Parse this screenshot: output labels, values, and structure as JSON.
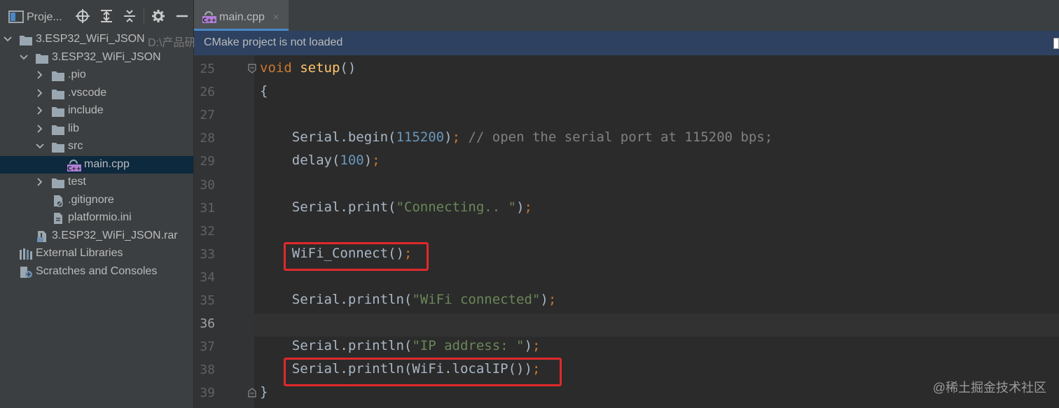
{
  "project_panel": {
    "title": "Proje...",
    "header_icons": [
      "locate-icon",
      "expand-all-icon",
      "collapse-all-icon",
      "gear-icon",
      "minimize-icon"
    ],
    "tree": [
      {
        "label": "3.ESP32_WiFi_JSON",
        "hint": "D:\\产品研发",
        "indent": 0,
        "arrow": "down",
        "icon": "folder"
      },
      {
        "label": "3.ESP32_WiFi_JSON",
        "hint": "",
        "indent": 1,
        "arrow": "down",
        "icon": "folder"
      },
      {
        "label": ".pio",
        "hint": "",
        "indent": 2,
        "arrow": "right",
        "icon": "folder"
      },
      {
        "label": ".vscode",
        "hint": "",
        "indent": 2,
        "arrow": "right",
        "icon": "folder"
      },
      {
        "label": "include",
        "hint": "",
        "indent": 2,
        "arrow": "right",
        "icon": "folder"
      },
      {
        "label": "lib",
        "hint": "",
        "indent": 2,
        "arrow": "right",
        "icon": "folder"
      },
      {
        "label": "src",
        "hint": "",
        "indent": 2,
        "arrow": "down",
        "icon": "folder"
      },
      {
        "label": "main.cpp",
        "hint": "",
        "indent": 3,
        "arrow": "none",
        "icon": "cpp",
        "selected": true
      },
      {
        "label": "test",
        "hint": "",
        "indent": 2,
        "arrow": "right",
        "icon": "folder"
      },
      {
        "label": ".gitignore",
        "hint": "",
        "indent": 2,
        "arrow": "none",
        "icon": "file-ignored"
      },
      {
        "label": "platformio.ini",
        "hint": "",
        "indent": 2,
        "arrow": "none",
        "icon": "file"
      },
      {
        "label": "3.ESP32_WiFi_JSON.rar",
        "hint": "",
        "indent": 1,
        "arrow": "none",
        "icon": "archive"
      },
      {
        "label": "External Libraries",
        "hint": "",
        "indent": 0,
        "arrow": "none",
        "icon": "libraries"
      },
      {
        "label": "Scratches and Consoles",
        "hint": "",
        "indent": 0,
        "arrow": "none",
        "icon": "scratches"
      }
    ]
  },
  "editor": {
    "tab": {
      "label": "main.cpp",
      "close": "×",
      "icon": "cpp-file-icon"
    },
    "banner": "CMake project is not loaded",
    "current_line": "36",
    "lines": [
      {
        "num": "25",
        "tokens": [
          [
            "kw",
            "void"
          ],
          [
            "plain",
            " "
          ],
          [
            "fn",
            "setup"
          ],
          [
            "plain",
            "()"
          ]
        ]
      },
      {
        "num": "26",
        "tokens": [
          [
            "plain",
            "{"
          ]
        ]
      },
      {
        "num": "27",
        "tokens": []
      },
      {
        "num": "28",
        "tokens": [
          [
            "plain",
            "    Serial.begin("
          ],
          [
            "num",
            "115200"
          ],
          [
            "plain",
            ")"
          ],
          [
            "kw",
            ";"
          ],
          [
            "plain",
            " "
          ],
          [
            "cmt",
            "// open the serial port at 115200 bps;"
          ]
        ]
      },
      {
        "num": "29",
        "tokens": [
          [
            "plain",
            "    delay("
          ],
          [
            "num",
            "100"
          ],
          [
            "plain",
            ")"
          ],
          [
            "kw",
            ";"
          ]
        ]
      },
      {
        "num": "30",
        "tokens": []
      },
      {
        "num": "31",
        "tokens": [
          [
            "plain",
            "    Serial.print("
          ],
          [
            "str",
            "\"Connecting.. \""
          ],
          [
            "plain",
            ")"
          ],
          [
            "kw",
            ";"
          ]
        ]
      },
      {
        "num": "32",
        "tokens": []
      },
      {
        "num": "33",
        "tokens": [
          [
            "plain",
            "    WiFi_Connect()"
          ],
          [
            "kw",
            ";"
          ]
        ]
      },
      {
        "num": "34",
        "tokens": []
      },
      {
        "num": "35",
        "tokens": [
          [
            "plain",
            "    Serial.println("
          ],
          [
            "str",
            "\"WiFi connected\""
          ],
          [
            "plain",
            ")"
          ],
          [
            "kw",
            ";"
          ]
        ]
      },
      {
        "num": "36",
        "tokens": []
      },
      {
        "num": "37",
        "tokens": [
          [
            "plain",
            "    Serial.println("
          ],
          [
            "str",
            "\"IP address: \""
          ],
          [
            "plain",
            ")"
          ],
          [
            "kw",
            ";"
          ]
        ]
      },
      {
        "num": "38",
        "tokens": [
          [
            "plain",
            "    Serial.println(WiFi.localIP())"
          ],
          [
            "kw",
            ";"
          ]
        ]
      },
      {
        "num": "39",
        "tokens": [
          [
            "plain",
            "}"
          ]
        ]
      }
    ],
    "highlighted_lines": [
      "33",
      "38"
    ]
  },
  "watermark": "@稀土掘金技术社区",
  "colors": {
    "highlight_box": "#e0292c",
    "selection": "#0d293e",
    "banner": "#2e4160"
  }
}
